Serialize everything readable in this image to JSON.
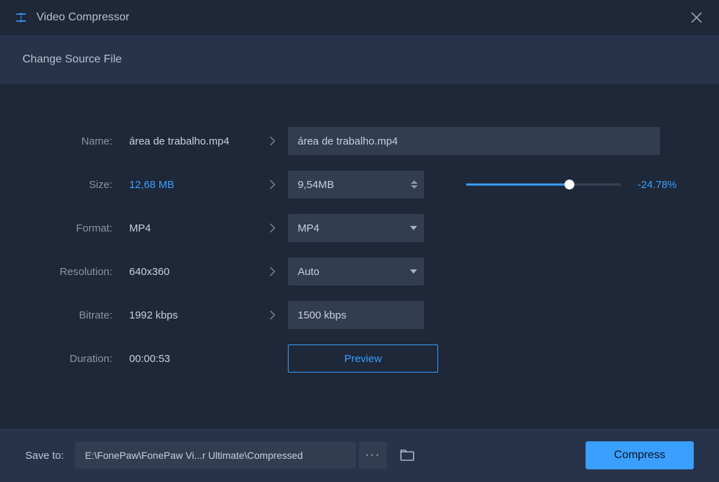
{
  "app": {
    "title": "Video Compressor"
  },
  "sourcebar": {
    "label": "Change Source File"
  },
  "rows": {
    "name": {
      "label": "Name:",
      "value": "área de trabalho.mp4",
      "target": "área de trabalho.mp4"
    },
    "size": {
      "label": "Size:",
      "value": "12,68 MB",
      "target": "9,54MB",
      "percent": "-24.78%",
      "fill_pct": 67
    },
    "format": {
      "label": "Format:",
      "value": "MP4",
      "target": "MP4"
    },
    "resolution": {
      "label": "Resolution:",
      "value": "640x360",
      "target": "Auto"
    },
    "bitrate": {
      "label": "Bitrate:",
      "value": "1992 kbps",
      "target": "1500 kbps"
    },
    "duration": {
      "label": "Duration:",
      "value": "00:00:53"
    }
  },
  "buttons": {
    "preview": "Preview",
    "compress": "Compress"
  },
  "footer": {
    "saveto": "Save to:",
    "path": "E:\\FonePaw\\FonePaw Vi...r Ultimate\\Compressed"
  }
}
